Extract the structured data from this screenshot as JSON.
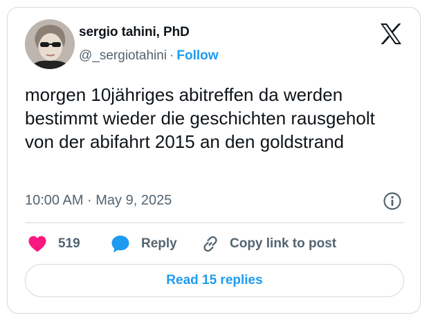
{
  "author": {
    "name": "sergio tahini, PhD",
    "handle": "@_sergiotahini",
    "separator": "·",
    "follow_label": "Follow"
  },
  "tweet": {
    "text": "morgen 10jähriges abitreffen da werden bestimmt wieder die geschichten rausgeholt von der abifahrt 2015 an den goldstrand",
    "timestamp": "10:00 AM · May 9, 2025"
  },
  "actions": {
    "like_count": "519",
    "reply_label": "Reply",
    "copy_label": "Copy link to post"
  },
  "read_replies_label": "Read 15 replies",
  "icons": {
    "logo": "x-logo-icon",
    "info": "info-icon",
    "like": "heart-icon",
    "reply": "speech-bubble-icon",
    "copy": "link-icon"
  },
  "colors": {
    "accent": "#1d9bf0",
    "like": "#f91880",
    "text": "#0f1419",
    "secondary": "#536471",
    "border": "#cfd9de"
  }
}
